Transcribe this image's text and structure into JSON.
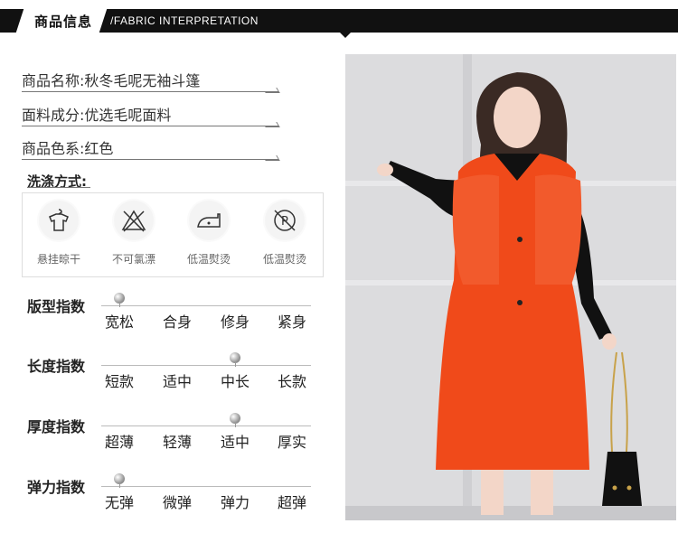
{
  "header": {
    "title": "商品信息",
    "subtitle": "/FABRIC INTERPRETATION"
  },
  "info": {
    "name": "商品名称:秋冬毛呢无袖斗篷",
    "material": "面料成分:优选毛呢面料",
    "color": "商品色系:红色"
  },
  "washing": {
    "title": "洗涤方式:",
    "items": [
      {
        "label": "悬挂晾干",
        "icon": "hanging-shirt-icon"
      },
      {
        "label": "不可氯漂",
        "icon": "no-bleach-icon"
      },
      {
        "label": "低温熨烫",
        "icon": "low-iron-icon"
      },
      {
        "label": "低温熨烫",
        "icon": "dry-clean-p-icon"
      }
    ]
  },
  "indices": [
    {
      "label": "版型指数",
      "options": [
        "宽松",
        "合身",
        "修身",
        "紧身"
      ],
      "selected": 0
    },
    {
      "label": "长度指数",
      "options": [
        "短款",
        "适中",
        "中长",
        "长款"
      ],
      "selected": 2
    },
    {
      "label": "厚度指数",
      "options": [
        "超薄",
        "轻薄",
        "适中",
        "厚实"
      ],
      "selected": 2
    },
    {
      "label": "弹力指数",
      "options": [
        "无弹",
        "微弹",
        "弹力",
        "超弹"
      ],
      "selected": 0
    }
  ],
  "colors": {
    "coat": "#f04a1a",
    "header": "#111111"
  }
}
